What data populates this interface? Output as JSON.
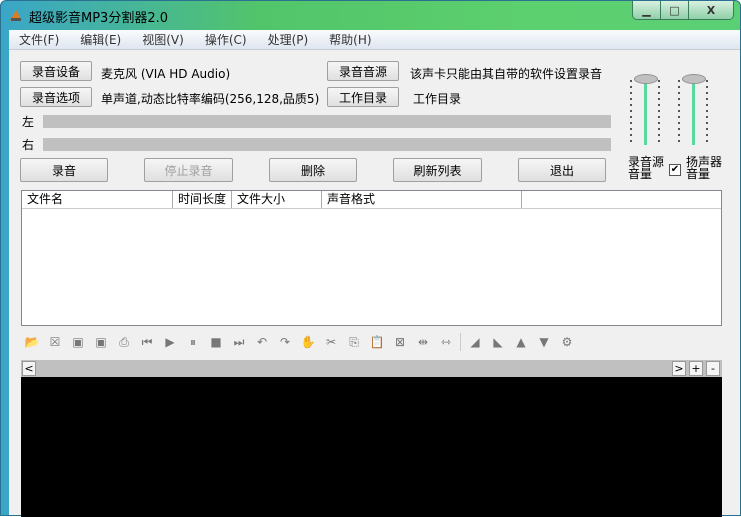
{
  "window": {
    "title": "超级影音MP3分割器2.0",
    "minimize": "▁",
    "maximize": "□",
    "close": "X"
  },
  "menu": [
    "文件(F)",
    "编辑(E)",
    "视图(V)",
    "操作(C)",
    "处理(P)",
    "帮助(H)"
  ],
  "record": {
    "device_button": "录音设备",
    "device_value": "麦克风 (VIA HD Audio)",
    "options_button": "录音选项",
    "options_value": "单声道,动态比特率编码(256,128,品质5)",
    "source_button": "录音音源",
    "source_value": "该声卡只能由其自带的软件设置录音",
    "dir_button": "工作目录",
    "dir_value": "工作目录",
    "left_label": "左",
    "right_label": "右"
  },
  "actions": {
    "record": "录音",
    "stop": "停止录音",
    "delete": "删除",
    "refresh": "刷新列表",
    "exit": "退出"
  },
  "volume": {
    "source_label": "录音源音量",
    "speaker_label": "扬声器音量",
    "speaker_checked": true
  },
  "list": {
    "columns": [
      "文件名",
      "时间长度",
      "文件大小",
      "声音格式",
      ""
    ]
  },
  "toolbar": [
    "open",
    "close-file",
    "save",
    "save-as",
    "export",
    "go-start",
    "play",
    "pause",
    "stop",
    "go-end",
    "undo",
    "redo",
    "hand",
    "cut",
    "copy",
    "paste",
    "paste-replace",
    "insert-silence",
    "trim",
    "fade-in",
    "fade-out",
    "volume-up",
    "volume-down",
    "effects"
  ],
  "wave": {
    "scroll_left": "<",
    "scroll_right": ">",
    "zoom_in": "+",
    "zoom_out": "-"
  }
}
